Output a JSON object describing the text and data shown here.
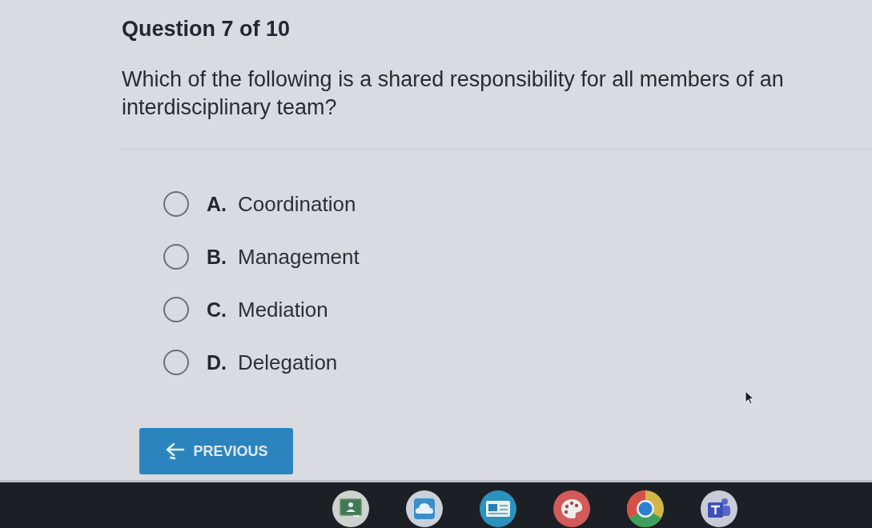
{
  "header": {
    "title": "Question 7 of 10"
  },
  "question": {
    "text": "Which of the following is a shared responsibility for all members of an interdisciplinary team?"
  },
  "options": [
    {
      "letter": "A.",
      "label": "Coordination",
      "selected": false
    },
    {
      "letter": "B.",
      "label": "Management",
      "selected": false
    },
    {
      "letter": "C.",
      "label": "Mediation",
      "selected": false
    },
    {
      "letter": "D.",
      "label": "Delegation",
      "selected": false
    }
  ],
  "navigation": {
    "previous_button": {
      "label": "PREVIOUS"
    }
  }
}
